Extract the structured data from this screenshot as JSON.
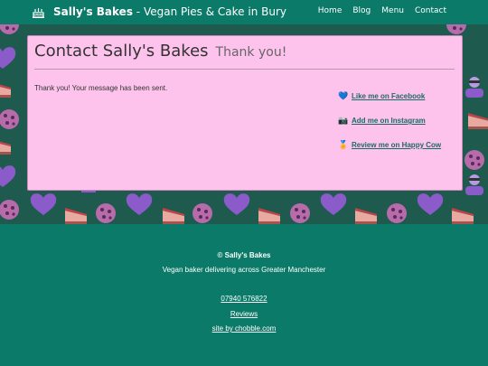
{
  "header": {
    "brand_name": "Sally's Bakes",
    "brand_tagline": "- Vegan Pies & Cake in Bury",
    "nav": [
      "Home",
      "Blog",
      "Menu",
      "Contact"
    ]
  },
  "card": {
    "title": "Contact Sally's Bakes",
    "subtitle": "Thank you!",
    "message": "Thank you! Your message has been sent.",
    "links": [
      {
        "icon": "blue-heart-icon",
        "glyph": "💙",
        "label": "Like me on Facebook"
      },
      {
        "icon": "camera-icon",
        "glyph": "📷",
        "label": "Add me on Instagram"
      },
      {
        "icon": "review-icon",
        "glyph": "🏅",
        "label": "Review me on Happy Cow"
      }
    ]
  },
  "footer": {
    "copyright": "© Sally's Bakes",
    "tagline": "Vegan baker delivering across Greater Manchester",
    "phone": "07940 576822",
    "reviews": "Reviews",
    "credit": "site by chobble.com"
  },
  "colors": {
    "header_bg": "#0b7a68",
    "pattern_bg": "#1f5a4f",
    "card_bg": "#fdc3ec",
    "link": "#1a6b67"
  }
}
